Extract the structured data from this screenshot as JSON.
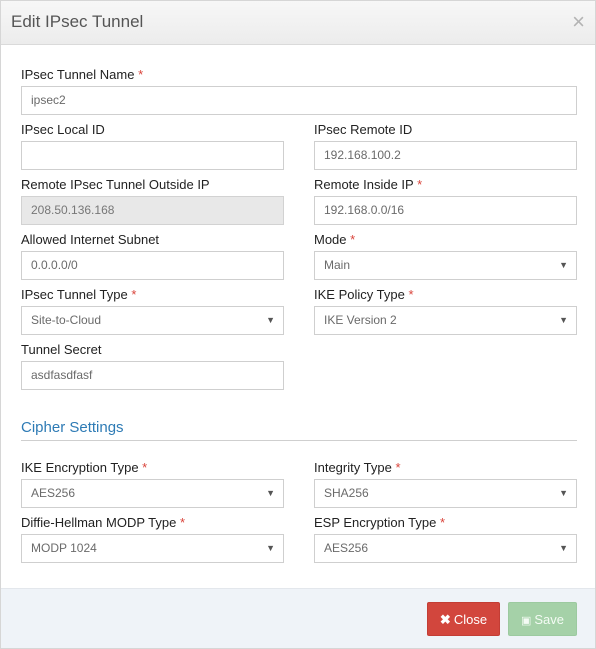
{
  "modal": {
    "title": "Edit IPsec Tunnel",
    "close_glyph": "×"
  },
  "required_marker": "*",
  "fields": {
    "tunnel_name": {
      "label": "IPsec Tunnel Name",
      "value": "ipsec2"
    },
    "local_id": {
      "label": "IPsec Local ID",
      "value": ""
    },
    "remote_id": {
      "label": "IPsec Remote ID",
      "value": "192.168.100.2"
    },
    "remote_outside_ip": {
      "label": "Remote IPsec Tunnel Outside IP",
      "value": "208.50.136.168"
    },
    "remote_inside_ip": {
      "label": "Remote Inside IP",
      "value": "192.168.0.0/16"
    },
    "allowed_subnet": {
      "label": "Allowed Internet Subnet",
      "value": "0.0.0.0/0"
    },
    "mode": {
      "label": "Mode",
      "value": "Main"
    },
    "tunnel_type": {
      "label": "IPsec Tunnel Type",
      "value": "Site-to-Cloud"
    },
    "ike_policy": {
      "label": "IKE Policy Type",
      "value": "IKE Version 2"
    },
    "tunnel_secret": {
      "label": "Tunnel Secret",
      "value": "asdfasdfasf"
    }
  },
  "cipher": {
    "section_title": "Cipher Settings",
    "ike_encryption": {
      "label": "IKE Encryption Type",
      "value": "AES256"
    },
    "integrity": {
      "label": "Integrity Type",
      "value": "SHA256"
    },
    "dh_modp": {
      "label": "Diffie-Hellman MODP Type",
      "value": "MODP 1024"
    },
    "esp_encryption": {
      "label": "ESP Encryption Type",
      "value": "AES256"
    }
  },
  "footer": {
    "close_icon": "✖",
    "close_label": "Close",
    "save_icon": "💾",
    "save_label": "Save"
  },
  "colors": {
    "accent": "#2e7bb5",
    "danger": "#d2463d",
    "success_disabled": "#a5d1a8",
    "required": "#d9433a"
  }
}
